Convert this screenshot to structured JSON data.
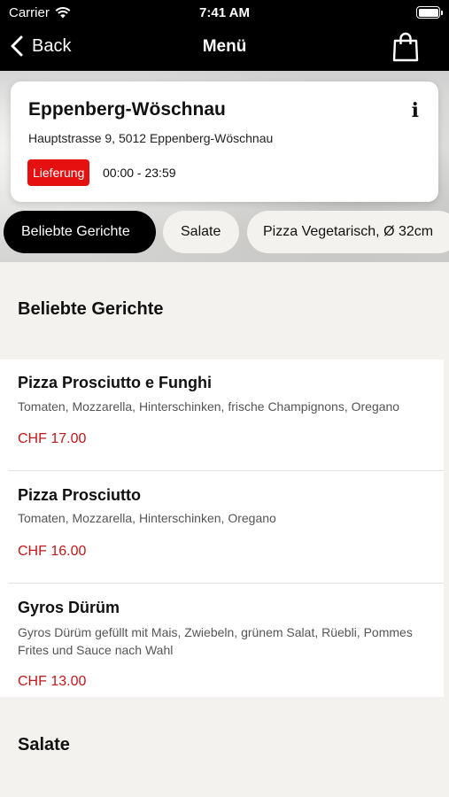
{
  "status_bar": {
    "carrier": "Carrier",
    "time": "7:41 AM"
  },
  "nav": {
    "back_label": "Back",
    "title": "Menü"
  },
  "store": {
    "name": "Eppenberg-Wöschnau",
    "address": "Hauptstrasse 9, 5012 Eppenberg-Wöschnau",
    "badge": "Lieferung",
    "hours": "00:00 - 23:59"
  },
  "tabs": [
    {
      "label": "Beliebte Gerichte",
      "active": true
    },
    {
      "label": "Salate",
      "active": false
    },
    {
      "label": "Pizza Vegetarisch, Ø 32cm",
      "active": false
    }
  ],
  "sections": [
    {
      "title": "Beliebte Gerichte",
      "items": [
        {
          "name": "Pizza Prosciutto e Funghi",
          "description": "Tomaten, Mozzarella, Hinterschinken, frische Champignons, Oregano",
          "price": "CHF 17.00"
        },
        {
          "name": "Pizza Prosciutto",
          "description": "Tomaten, Mozzarella, Hinterschinken, Oregano",
          "price": "CHF 16.00"
        },
        {
          "name": "Gyros Dürüm",
          "description": "Gyros Dürüm gefüllt mit Mais, Zwiebeln, grünem Salat, Rüebli, Pommes Frites und Sauce nach Wahl",
          "price": "CHF 13.00"
        }
      ]
    },
    {
      "title": "Salate",
      "items": []
    }
  ],
  "colors": {
    "badge": "#e61010",
    "price": "#c0181a",
    "active_tab": "#000000"
  }
}
